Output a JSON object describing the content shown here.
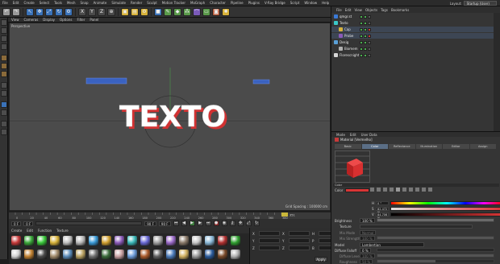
{
  "menu": [
    "File",
    "Edit",
    "Create",
    "Select",
    "Tools",
    "Mesh",
    "Snap",
    "Animate",
    "Simulate",
    "Render",
    "Sculpt",
    "Motion Tracker",
    "MoGraph",
    "Character",
    "Pipeline",
    "Plugins",
    "V-Ray Bridge",
    "Script",
    "Window",
    "Help"
  ],
  "layout": {
    "label": "Layout:",
    "value": "Startup (User)"
  },
  "viewport": {
    "menu": [
      "View",
      "Cameras",
      "Display",
      "Options",
      "Filter",
      "Panel"
    ],
    "name": "Perspective",
    "grid_spacing": "Grid Spacing : 100000 cm",
    "scene_text": "TEXTO",
    "colors": {
      "background": "#4b4b4b",
      "text_face": "#ffffff",
      "text_side": "#d23232"
    }
  },
  "timeline": {
    "ticks": [
      "0",
      "10",
      "20",
      "30",
      "40",
      "50",
      "60",
      "70",
      "80",
      "90",
      "100",
      "110",
      "120",
      "130",
      "140",
      "150",
      "160",
      "170",
      "180",
      "190",
      "200",
      "210",
      "220",
      "230",
      "240",
      "250",
      "260",
      "270",
      "280",
      "290",
      "300",
      "310",
      "320",
      "330",
      "340",
      "350",
      "360",
      "370",
      "380"
    ],
    "current_frame": "0 F",
    "min_frame": "0 F",
    "max_frame": "90 F",
    "end_frame": "90 F",
    "playhead_marker": "351"
  },
  "materials": {
    "menu": [
      "Create",
      "Edit",
      "Function",
      "Texture"
    ],
    "swatches": [
      "#c83a3a",
      "#3aa83a",
      "#3ac83a",
      "#d7b23a",
      "#c0c0c0",
      "#b8b8b8",
      "#3a9ad7",
      "#d0a030",
      "#8a5ab8",
      "#3ab8b8",
      "#6a6ad7",
      "#a0a0a0",
      "#9a6ac8",
      "#8a7a6a",
      "#c8c8c8",
      "#8ab8d7",
      "#b03030",
      "#30a030",
      "#d0d0d0",
      "#c08030",
      "#4a4a4a",
      "#a08a6a",
      "#5a8ab8",
      "#b8a060",
      "#707070",
      "#3a6a3a",
      "#c8a0a0",
      "#6a9ad7",
      "#aa5a2a",
      "#606060",
      "#4a7ab8",
      "#d0b060",
      "#9a9a9a",
      "#2a5a9a",
      "#7a4a2a",
      "#b0b0b0"
    ]
  },
  "coordinates": {
    "rows": [
      {
        "a": "X",
        "b": "X",
        "c": "H"
      },
      {
        "a": "Y",
        "b": "Y",
        "c": "P"
      },
      {
        "a": "Z",
        "b": "Z",
        "c": "B"
      }
    ],
    "apply": "Apply"
  },
  "object_manager": {
    "menu": [
      "File",
      "Edit",
      "View",
      "Objects",
      "Tags",
      "Bookmarks"
    ],
    "objects": [
      {
        "name": "qmgr.st",
        "indent": 0,
        "color": "#3a7ad7",
        "flags": [
          "g",
          "g",
          "n"
        ]
      },
      {
        "name": "Texto",
        "indent": 0,
        "color": "#3ac8c8",
        "flags": [
          "g",
          "g",
          "n"
        ]
      },
      {
        "name": "Cap",
        "indent": 1,
        "color": "#d7b23a",
        "flags": [
          "g",
          "g",
          "r"
        ]
      },
      {
        "name": "Probe",
        "indent": 1,
        "color": "#8a5ab8",
        "flags": [
          "g",
          "g",
          "r"
        ]
      },
      {
        "name": "Desig",
        "indent": 0,
        "color": "#5aa0d7",
        "flags": [
          "g",
          "g",
          "n"
        ]
      },
      {
        "name": "Biomem",
        "indent": 1,
        "color": "#b0b0b0",
        "flags": [
          "g",
          "g",
          "n"
        ]
      },
      {
        "name": "Florescnight",
        "indent": 0,
        "color": "#d7d7d7",
        "flags": [
          "g",
          "g",
          "n"
        ]
      }
    ]
  },
  "attribute_manager": {
    "menu": [
      "Mode",
      "Edit",
      "User Data"
    ],
    "title": "Material [Vermelho]",
    "tabs": [
      "Basic",
      "Color",
      "Reflectance",
      "Illumination",
      "Editor",
      "Assign"
    ],
    "active_tab": "Color",
    "section": "Color",
    "color_label": "Color",
    "channels": [
      {
        "label": "H",
        "value": "0 °"
      },
      {
        "label": "S",
        "value": "82.472 %"
      },
      {
        "label": "V",
        "value": "84.706 %"
      }
    ],
    "brightness": {
      "label": "Brightness",
      "value": "100 %",
      "level": 1.0
    },
    "texture": {
      "label": "Texture"
    },
    "mix_mode": {
      "label": "Mix Mode",
      "value": "Normal"
    },
    "mix_strength": {
      "label": "Mix Strength",
      "value": "100 %",
      "level": 1.0
    },
    "model": {
      "label": "Model",
      "value": "Lambertian"
    },
    "diffuse_falloff": {
      "label": "Diffuse Falloff",
      "value": "0 %",
      "level": 0.0
    },
    "diffuse_level": {
      "label": "Diffuse Level",
      "value": "100 %",
      "level": 1.0
    },
    "roughness": {
      "label": "Roughness",
      "value": "50 %",
      "level": 0.5
    },
    "swatch_color": "#d93535"
  }
}
